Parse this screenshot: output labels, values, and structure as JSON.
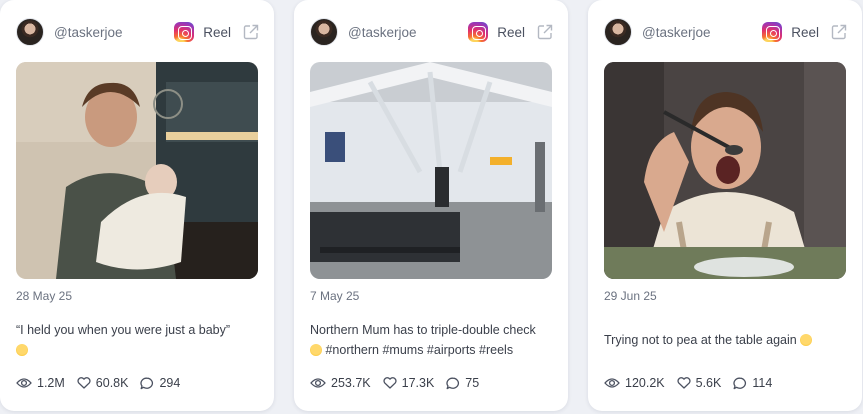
{
  "cards": [
    {
      "handle": "@taskerjoe",
      "platform_icon": "instagram-icon",
      "type": "Reel",
      "date": "28 May 25",
      "caption": "“I held you when you were just a baby”",
      "caption_emoji": "grinning-face-emoji",
      "views": "1.2M",
      "likes": "60.8K",
      "comments": "294"
    },
    {
      "handle": "@taskerjoe",
      "platform_icon": "instagram-icon",
      "type": "Reel",
      "date": "7 May 25",
      "caption_line1": "Northern Mum has to triple-double check",
      "caption_line2": "#northern #mums #airports #reels",
      "caption_emoji": "grinning-face-emoji",
      "views": "253.7K",
      "likes": "17.3K",
      "comments": "75"
    },
    {
      "handle": "@taskerjoe",
      "platform_icon": "instagram-icon",
      "type": "Reel",
      "date": "29 Jun 25",
      "caption": "Trying not to pea at the table again",
      "caption_emoji": "face-savoring-food-emoji",
      "views": "120.2K",
      "likes": "5.6K",
      "comments": "114"
    }
  ],
  "colors": {
    "page_background": "#eef0f5",
    "card_background": "#ffffff",
    "muted_text": "#6b7280",
    "icon_gray": "#9aa1ad"
  }
}
